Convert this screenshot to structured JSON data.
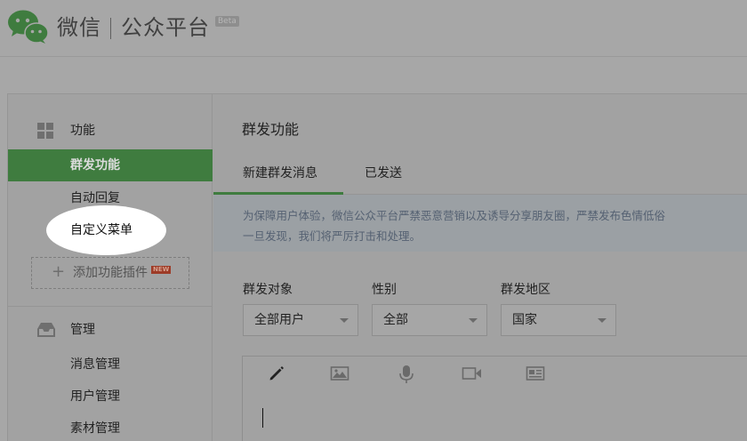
{
  "header": {
    "brand_name": "微信",
    "product_name": "公众平台",
    "beta_label": "Beta"
  },
  "sidebar": {
    "sections": [
      {
        "label": "功能",
        "icon": "grid-icon",
        "items": [
          "群发功能",
          "自动回复",
          "自定义菜单"
        ],
        "active_item": "群发功能",
        "highlighted_item": "自定义菜单",
        "add_plugin_label": "添加功能插件",
        "new_badge": "NEW"
      },
      {
        "label": "管理",
        "icon": "inbox-icon",
        "items": [
          "消息管理",
          "用户管理",
          "素材管理"
        ]
      }
    ]
  },
  "main": {
    "title": "群发功能",
    "tabs": [
      {
        "label": "新建群发消息",
        "active": true
      },
      {
        "label": "已发送",
        "active": false
      }
    ],
    "notice_lines": [
      "为保障用户体验，微信公众平台严禁恶意营销以及诱导分享朋友圈，严禁发布色情低俗",
      "一旦发现，我们将严厉打击和处理。"
    ],
    "filters": [
      {
        "label": "群发对象",
        "value": "全部用户"
      },
      {
        "label": "性别",
        "value": "全部"
      },
      {
        "label": "群发地区",
        "value": "国家"
      }
    ],
    "editor_tools": [
      "pencil-icon",
      "image-icon",
      "microphone-icon",
      "video-icon",
      "news-card-icon"
    ]
  },
  "colors": {
    "accent": "#3f7c3f",
    "overlay_background": "#a7a7a7",
    "spotlight": "#ffffff"
  }
}
